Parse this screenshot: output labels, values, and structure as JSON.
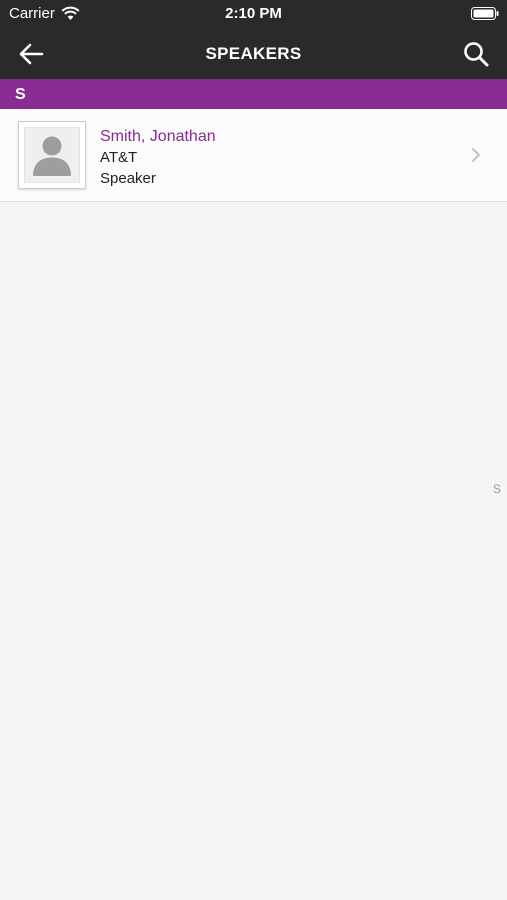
{
  "status_bar": {
    "carrier": "Carrier",
    "time": "2:10 PM"
  },
  "nav": {
    "title": "SPEAKERS"
  },
  "section": {
    "letter": "S"
  },
  "speakers": [
    {
      "name": "Smith, Jonathan",
      "company": "AT&T",
      "role": "Speaker"
    }
  ],
  "index": [
    "S"
  ],
  "colors": {
    "accent": "#8b2c95",
    "bar": "#2a2a2a",
    "background": "#f5f5f5"
  }
}
